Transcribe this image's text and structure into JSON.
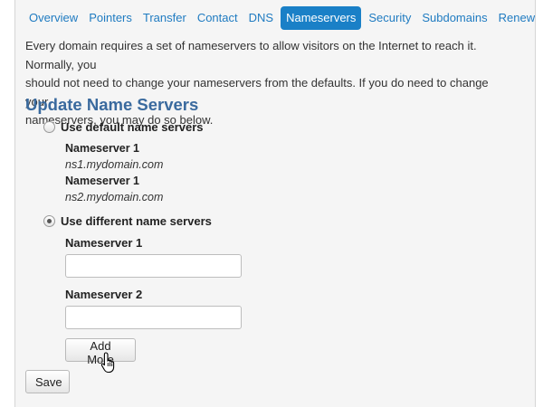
{
  "tabs": [
    {
      "label": "Overview",
      "active": false
    },
    {
      "label": "Pointers",
      "active": false
    },
    {
      "label": "Transfer",
      "active": false
    },
    {
      "label": "Contact",
      "active": false
    },
    {
      "label": "DNS",
      "active": false
    },
    {
      "label": "Nameservers",
      "active": true
    },
    {
      "label": "Security",
      "active": false
    },
    {
      "label": "Subdomains",
      "active": false
    },
    {
      "label": "Renew",
      "active": false
    }
  ],
  "intro": {
    "line1": "Every domain requires a set of nameservers to allow visitors on the Internet to reach it. Normally, you",
    "line2": "should not need to change your nameservers from the defaults. If you do need to change your",
    "line3": "nameservers, you may do so below."
  },
  "section_title": "Update Name Servers",
  "option_default": {
    "label": "Use default name servers",
    "selected": false,
    "servers": [
      {
        "label": "Nameserver 1",
        "value": "ns1.mydomain.com"
      },
      {
        "label": "Nameserver 1",
        "value": "ns2.mydomain.com"
      }
    ]
  },
  "option_different": {
    "label": "Use different name servers",
    "selected": true,
    "fields": [
      {
        "label": "Nameserver 1",
        "value": "",
        "placeholder": ""
      },
      {
        "label": "Nameserver 2",
        "value": "",
        "placeholder": ""
      }
    ]
  },
  "buttons": {
    "add_more": "Add More",
    "save": "Save"
  },
  "colors": {
    "link": "#1f7bc1",
    "active_tab": "#1a80c7",
    "section_title": "#3a6a9e"
  }
}
